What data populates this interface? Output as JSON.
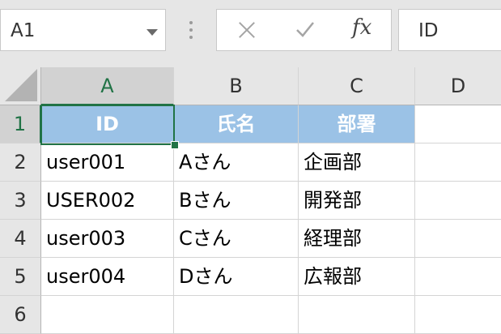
{
  "name_box": {
    "value": "A1"
  },
  "formula_bar": {
    "fx_label": "fx",
    "content": "ID"
  },
  "columns": [
    "A",
    "B",
    "C",
    "D"
  ],
  "rows": [
    "1",
    "2",
    "3",
    "4",
    "5",
    "6"
  ],
  "cells": {
    "r1": [
      "ID",
      "氏名",
      "部署"
    ],
    "r2": [
      "user001",
      "Aさん",
      "企画部"
    ],
    "r3": [
      "USER002",
      "Bさん",
      "開発部"
    ],
    "r4": [
      "user003",
      "Cさん",
      "経理部"
    ],
    "r5": [
      "user004",
      "Dさん",
      "広報部"
    ]
  },
  "colors": {
    "header_fill": "#9bc2e6",
    "selection": "#217346"
  }
}
